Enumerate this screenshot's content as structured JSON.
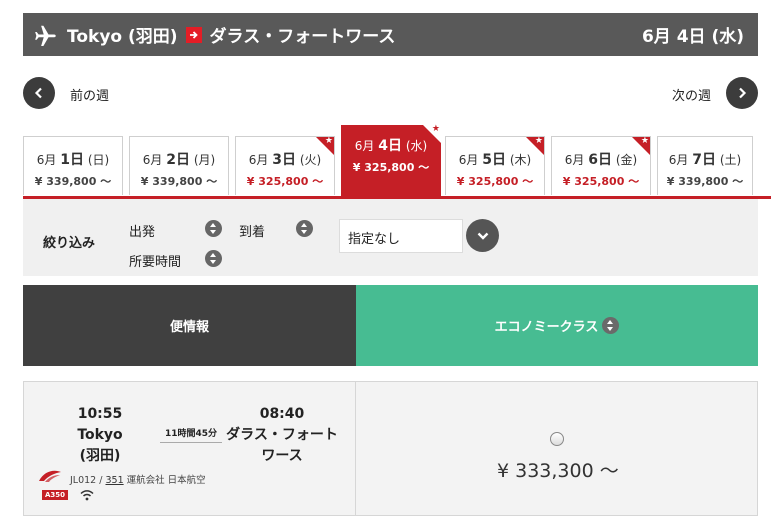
{
  "header": {
    "origin": "Tokyo (羽田)",
    "destination": "ダラス・フォートワース",
    "date": "6月 4日 (水)"
  },
  "week_nav": {
    "prev_label": "前の週",
    "next_label": "次の週"
  },
  "date_tabs": [
    {
      "month": "6月",
      "day": "1日",
      "weekday": "(日)",
      "price": "¥ 339,800 ～",
      "sale": false,
      "selected": false
    },
    {
      "month": "6月",
      "day": "2日",
      "weekday": "(月)",
      "price": "¥ 339,800 ～",
      "sale": false,
      "selected": false
    },
    {
      "month": "6月",
      "day": "3日",
      "weekday": "(火)",
      "price": "¥ 325,800 ～",
      "sale": true,
      "selected": false
    },
    {
      "month": "6月",
      "day": "4日",
      "weekday": "(水)",
      "price": "¥ 325,800 ～",
      "sale": true,
      "selected": true
    },
    {
      "month": "6月",
      "day": "5日",
      "weekday": "(木)",
      "price": "¥ 325,800 ～",
      "sale": true,
      "selected": false
    },
    {
      "month": "6月",
      "day": "6日",
      "weekday": "(金)",
      "price": "¥ 325,800 ～",
      "sale": true,
      "selected": false
    },
    {
      "month": "6月",
      "day": "7日",
      "weekday": "(土)",
      "price": "¥ 339,800 ～",
      "sale": false,
      "selected": false
    }
  ],
  "filter": {
    "title": "絞り込み",
    "departure_label": "出発",
    "arrival_label": "到着",
    "duration_label": "所要時間",
    "select_value": "指定なし"
  },
  "columns": {
    "flight_info": "便情報",
    "economy": "エコノミークラス"
  },
  "flight": {
    "dep_time": "10:55",
    "dep_city": "Tokyo\n(羽田)",
    "duration": "11時間45分",
    "arr_time": "08:40",
    "arr_city": "ダラス・フォート\nワース",
    "flight_prefix": "JL012 /",
    "flight_link": "351",
    "operator": "運航会社 日本航空",
    "aircraft": "A350",
    "fare": "¥ 333,300 ～"
  },
  "colors": {
    "brand_red": "#c51f26",
    "header_gray": "#595959",
    "economy_green": "#47bc92",
    "flight_header": "#404040"
  }
}
